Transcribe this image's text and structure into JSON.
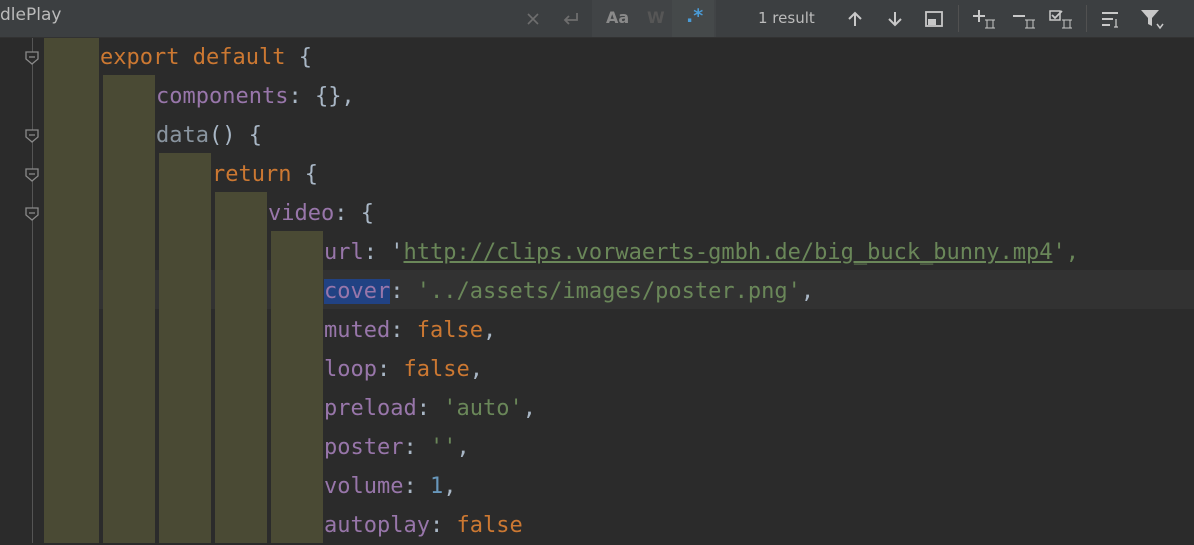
{
  "search": {
    "query": "dlePlay",
    "match_case_label": "Aa",
    "words_label": "W",
    "regex_label": ".*",
    "result_count": "1 result"
  },
  "toolbar_icons": [
    "clear-icon",
    "history-icon",
    "arrow-up-icon",
    "arrow-down-icon",
    "open-in-window-icon",
    "add-cursor-icon",
    "remove-cursor-icon",
    "select-all-occurrences-icon",
    "show-filter-icon",
    "filter-icon"
  ],
  "code": {
    "line1": [
      "export",
      " ",
      "default",
      " {"
    ],
    "line2": [
      "components",
      ": {},"
    ],
    "line3": [
      "data",
      "() {"
    ],
    "line4": [
      "return",
      " {"
    ],
    "line5": [
      "video",
      ": {"
    ],
    "line6": [
      "url",
      ": '",
      "http://clips.vorwaerts-gmbh.de/big_buck_bunny.mp4",
      "',"
    ],
    "line7": [
      "cover",
      ": ",
      "'../assets/images/poster.png'",
      ","
    ],
    "line8": [
      "muted",
      ": ",
      "false",
      ","
    ],
    "line9": [
      "loop",
      ": ",
      "false",
      ","
    ],
    "line10": [
      "preload",
      ": ",
      "'auto'",
      ","
    ],
    "line11": [
      "poster",
      ": ",
      "''",
      ","
    ],
    "line12": [
      "volume",
      ": ",
      "1",
      ","
    ],
    "line13": [
      "autoplay",
      ": ",
      "false"
    ]
  },
  "colors": {
    "keyword": "#cc7832",
    "property": "#9876aa",
    "string": "#6a8759",
    "number": "#6897bb",
    "default_text": "#a9b7c6",
    "background": "#2b2b2b",
    "selection": "#214283",
    "indent_guide": "#4a4a34"
  }
}
